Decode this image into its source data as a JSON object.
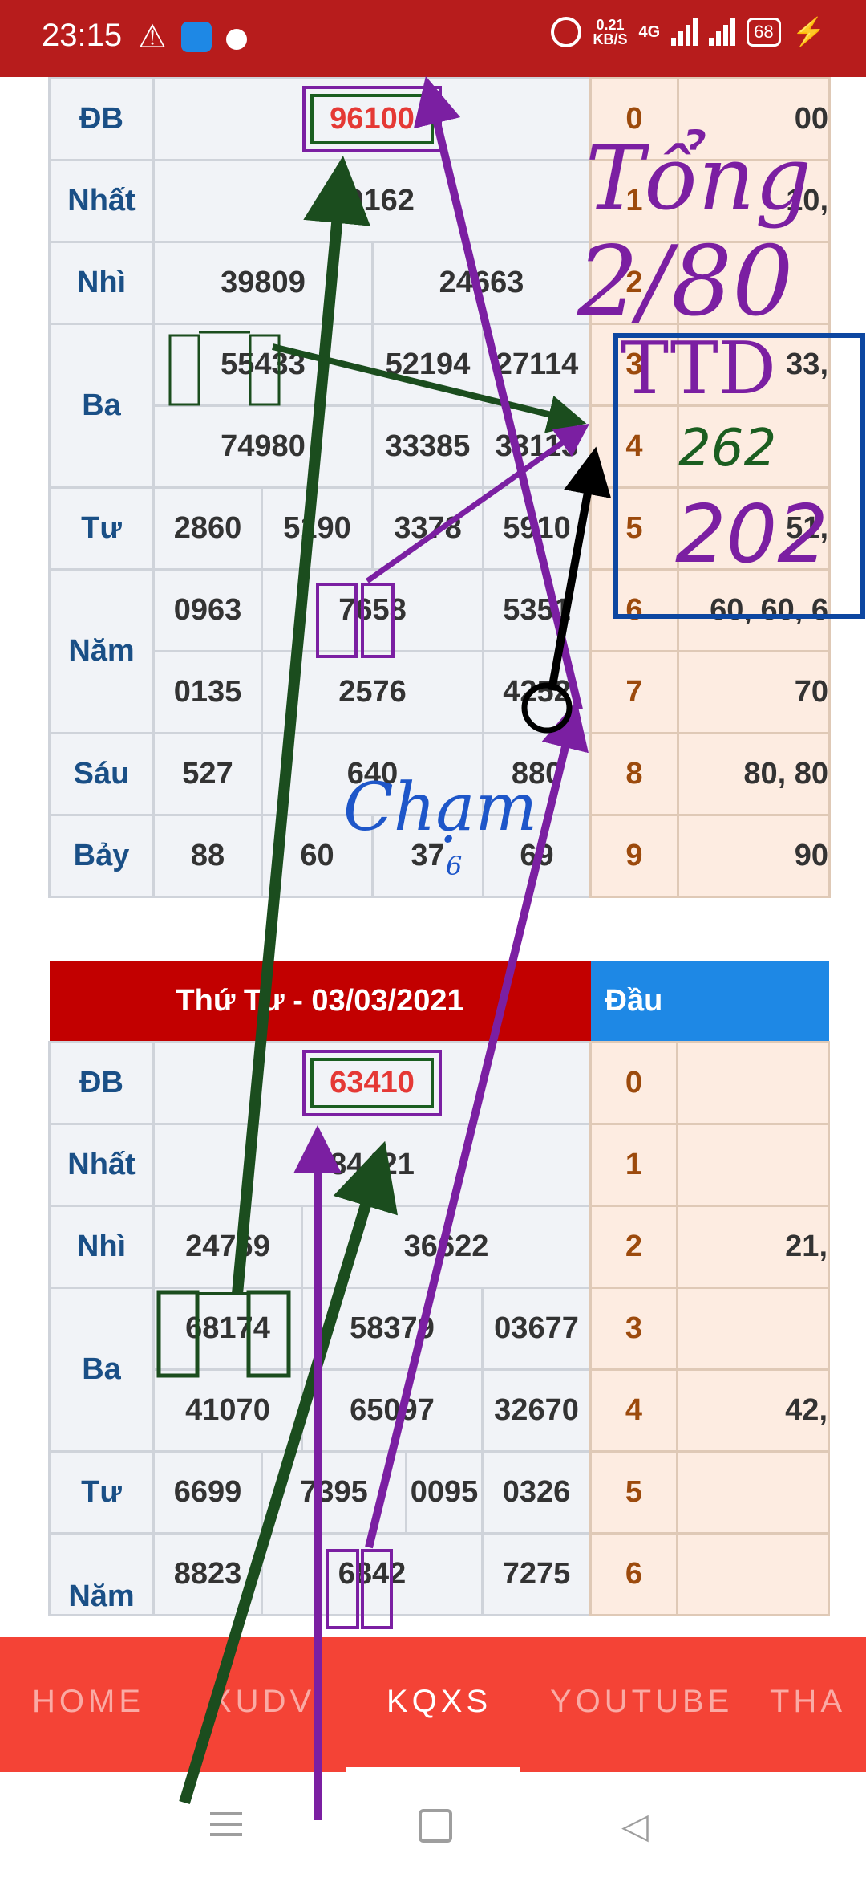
{
  "status_bar": {
    "time": "23:15",
    "speed": "0.21",
    "speed_unit": "KB/S",
    "network": "4G",
    "battery": "68"
  },
  "table1": {
    "rows": {
      "db": {
        "label": "ĐB",
        "values": [
          "96100"
        ]
      },
      "nhat": {
        "label": "Nhất",
        "values": [
          "19162"
        ]
      },
      "nhi": {
        "label": "Nhì",
        "values": [
          "39809",
          "24663"
        ]
      },
      "ba": {
        "label": "Ba",
        "values": [
          "55433",
          "52194",
          "27114",
          "74980",
          "33385",
          "33113"
        ]
      },
      "tu": {
        "label": "Tư",
        "values": [
          "2860",
          "5190",
          "3378",
          "5910"
        ]
      },
      "nam": {
        "label": "Năm",
        "values": [
          "0963",
          "7658",
          "5351",
          "0135",
          "2576",
          "4252"
        ]
      },
      "sau": {
        "label": "Sáu",
        "values": [
          "527",
          "640",
          "880"
        ]
      },
      "bay": {
        "label": "Bảy",
        "values": [
          "88",
          "60",
          "37",
          "69"
        ]
      }
    },
    "loto": [
      {
        "head": "0",
        "tail": "00"
      },
      {
        "head": "1",
        "tail": "10,"
      },
      {
        "head": "2",
        "tail": ""
      },
      {
        "head": "3",
        "tail": "33,"
      },
      {
        "head": "4",
        "tail": ""
      },
      {
        "head": "5",
        "tail": "51,"
      },
      {
        "head": "6",
        "tail": "60, 60, 6"
      },
      {
        "head": "7",
        "tail": "70"
      },
      {
        "head": "8",
        "tail": "80, 80"
      },
      {
        "head": "9",
        "tail": "90"
      }
    ]
  },
  "table2": {
    "title": "Thứ Tư - 03/03/2021",
    "loto_header": "Đầu",
    "rows": {
      "db": {
        "label": "ĐB",
        "values": [
          "63410"
        ]
      },
      "nhat": {
        "label": "Nhất",
        "values": [
          "84421"
        ]
      },
      "nhi": {
        "label": "Nhì",
        "values": [
          "24769",
          "36622"
        ]
      },
      "ba": {
        "label": "Ba",
        "values": [
          "68174",
          "58379",
          "03677",
          "41070",
          "65097",
          "32670"
        ]
      },
      "tu": {
        "label": "Tư",
        "values": [
          "6699",
          "7395",
          "0095",
          "0326"
        ]
      },
      "nam": {
        "label": "Năm",
        "values": [
          "8823",
          "6842",
          "7275"
        ]
      }
    },
    "loto": [
      {
        "head": "0",
        "tail": ""
      },
      {
        "head": "1",
        "tail": ""
      },
      {
        "head": "2",
        "tail": "21,"
      },
      {
        "head": "3",
        "tail": ""
      },
      {
        "head": "4",
        "tail": "42,"
      },
      {
        "head": "5",
        "tail": ""
      },
      {
        "head": "6",
        "tail": ""
      }
    ]
  },
  "annotations": {
    "tong_label": "Tổng",
    "tong_value": "2/80",
    "ttd_label": "TTD",
    "ttd_value_1": "262",
    "ttd_value_2": "202",
    "cham_label": "Chạm",
    "cham_digit": "6",
    "colors": {
      "green": "#1b4d1e",
      "purple": "#7b1fa2",
      "black": "#000000",
      "blue": "#0d47a1"
    }
  },
  "nav": {
    "items": [
      "HOME",
      "XUDV",
      "KQXS",
      "YOUTUBE",
      "THA"
    ],
    "active": "KQXS"
  }
}
